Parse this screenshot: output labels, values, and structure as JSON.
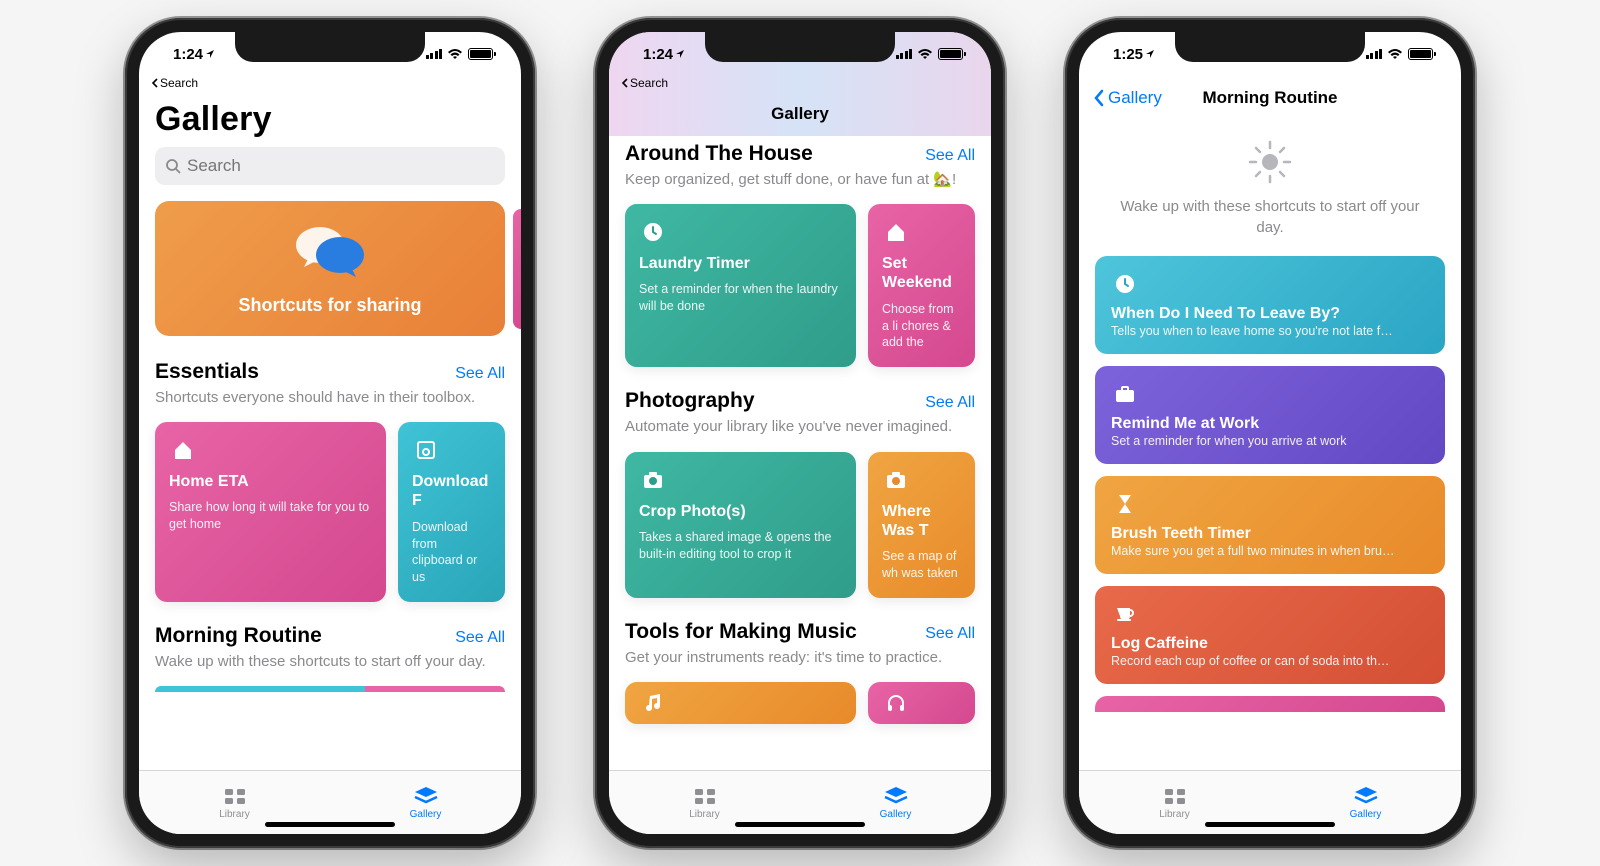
{
  "status": {
    "time_a": "1:24",
    "time_b": "1:25",
    "loc_arrow": "➤"
  },
  "back_to_search": "Search",
  "search_placeholder": "Search",
  "see_all": "See All",
  "tabs": {
    "library": "Library",
    "gallery": "Gallery"
  },
  "phone1": {
    "title": "Gallery",
    "hero": "Shortcuts for sharing",
    "essentials": {
      "title": "Essentials",
      "sub": "Shortcuts everyone should have in their toolbox."
    },
    "card1": {
      "title": "Home ETA",
      "sub": "Share how long it will take for you to get home"
    },
    "card2": {
      "title": "Download F",
      "sub": "Download from clipboard or us"
    },
    "morning": {
      "title": "Morning Routine",
      "sub": "Wake up with these shortcuts to start off your day."
    }
  },
  "phone2": {
    "title": "Gallery",
    "around": {
      "title": "Around The House",
      "sub": "Keep organized, get stuff done, or have fun at 🏡!"
    },
    "a_card1": {
      "title": "Laundry Timer",
      "sub": "Set a reminder for when the laundry will be done"
    },
    "a_card2": {
      "title": "Set Weekend",
      "sub": "Choose from a li chores & add the"
    },
    "photo": {
      "title": "Photography",
      "sub": "Automate your library like you've never imagined."
    },
    "p_card1": {
      "title": "Crop Photo(s)",
      "sub": "Takes a shared image & opens the built-in editing tool to crop it"
    },
    "p_card2": {
      "title": "Where Was T",
      "sub": "See a map of wh was taken"
    },
    "music": {
      "title": "Tools for Making Music",
      "sub": "Get your instruments ready: it's time to practice."
    }
  },
  "phone3": {
    "back": "Gallery",
    "title": "Morning Routine",
    "desc": "Wake up with these shortcuts to start off your day.",
    "s1": {
      "title": "When Do I Need To Leave By?",
      "sub": "Tells you when to leave home so you're not late f…"
    },
    "s2": {
      "title": "Remind Me at Work",
      "sub": "Set a reminder for when you arrive at work"
    },
    "s3": {
      "title": "Brush Teeth Timer",
      "sub": "Make sure you get a full two minutes in when bru…"
    },
    "s4": {
      "title": "Log Caffeine",
      "sub": "Record each cup of coffee or can of soda into th…"
    }
  },
  "colors": {
    "pink": "linear-gradient(135deg,#e864a6,#d4488f)",
    "teal": "linear-gradient(135deg,#3fc3d6,#2aa5b8)",
    "green": "linear-gradient(135deg,#3fb8a3,#2f9d8a)",
    "orange": "linear-gradient(135deg,#f0a542,#e88a2a)",
    "purple": "linear-gradient(135deg,#7d63db,#6348c4)",
    "red": "linear-gradient(135deg,#e86a4a,#d44f34)",
    "cyan": "linear-gradient(135deg,#4ec5db,#2aa5c4)"
  }
}
